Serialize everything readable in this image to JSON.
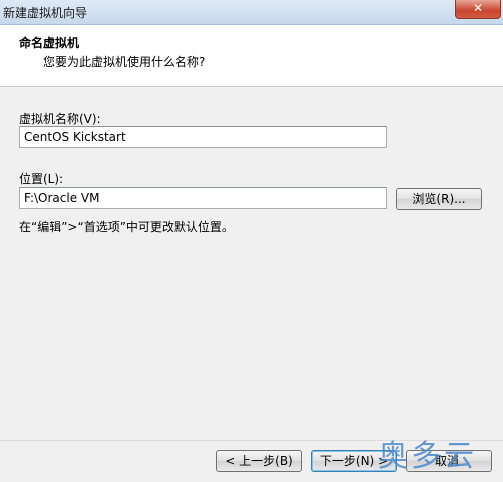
{
  "window": {
    "title": "新建虚拟机向导",
    "close_label": "✕"
  },
  "header": {
    "title": "命名虚拟机",
    "subtitle": "您要为此虚拟机使用什么名称?"
  },
  "form": {
    "name_label": "虚拟机名称(V):",
    "name_value": "CentOS Kickstart",
    "location_label": "位置(L):",
    "location_value": "F:\\Oracle VM",
    "browse_label": "浏览(R)...",
    "hint": "在“编辑”>“首选项”中可更改默认位置。"
  },
  "footer": {
    "back_label": "< 上一步(B)",
    "next_label": "下一步(N) >",
    "cancel_label": "取消"
  },
  "watermark": "奥多云"
}
